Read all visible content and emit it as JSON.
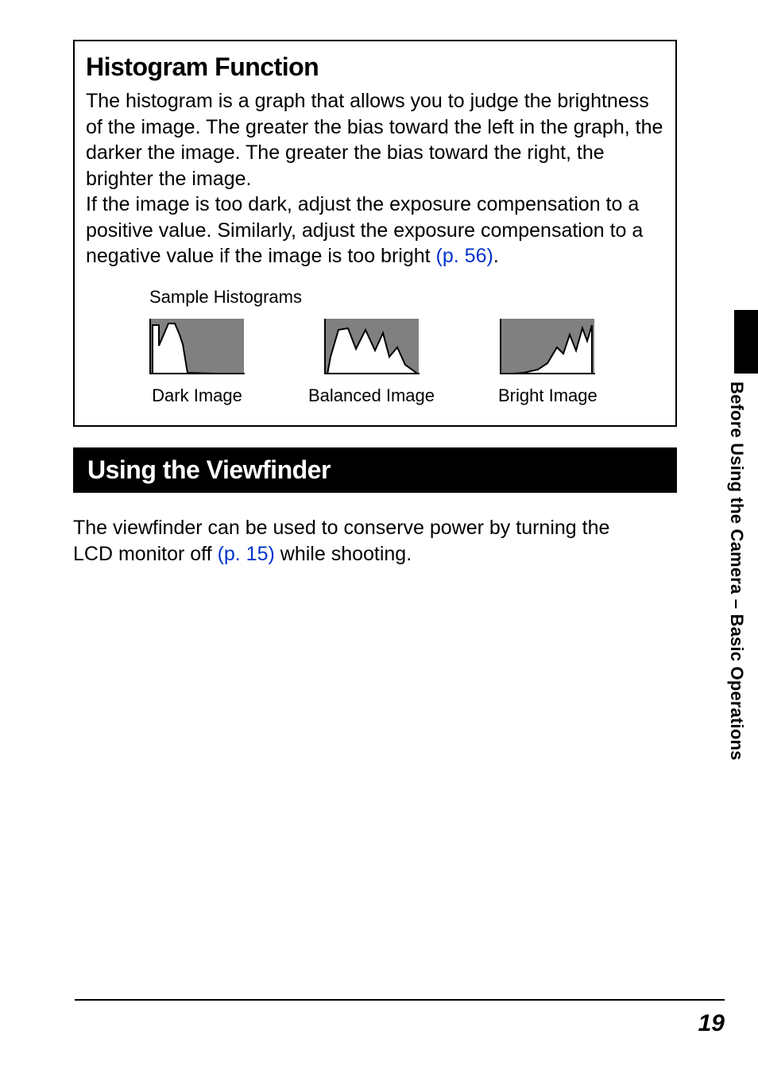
{
  "histogram_box": {
    "title": "Histogram Function",
    "paragraph1": "The histogram is a graph that allows you to judge the brightness of the image. The greater the bias toward the left in the graph, the darker the image. The greater the bias toward the right, the brighter the image.",
    "paragraph2_pre": "If the image is too dark, adjust the exposure compensation to a positive value. Similarly, adjust the exposure compensation to a negative value if the image is too bright ",
    "paragraph2_link": "(p. 56)",
    "paragraph2_post": ".",
    "samples_label": "Sample Histograms",
    "caption_dark": "Dark Image",
    "caption_balanced": "Balanced Image",
    "caption_bright": "Bright Image"
  },
  "section_viewfinder": {
    "title": "Using the Viewfinder",
    "body_pre": "The viewfinder can be used to conserve power by turning the LCD monitor off ",
    "body_link": "(p. 15)",
    "body_post": " while shooting."
  },
  "side_label": "Before Using the Camera – Basic Operations",
  "page_number": "19"
}
